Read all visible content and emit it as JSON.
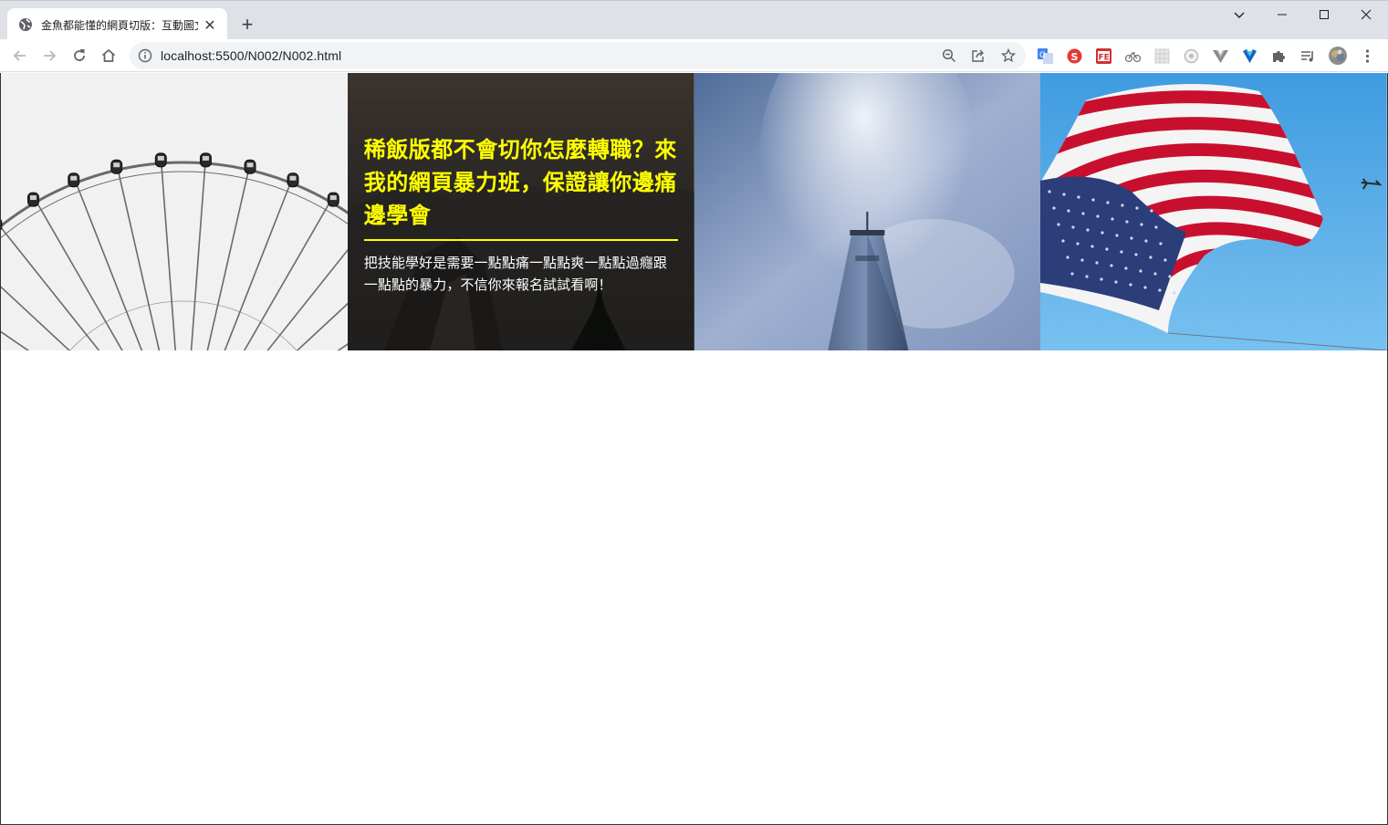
{
  "browser": {
    "tab": {
      "title": "金魚都能懂的網頁切版：互動圖文",
      "favicon": "globe-icon"
    },
    "address_bar": {
      "url": "localhost:5500/N002/N002.html"
    }
  },
  "page": {
    "headline": "稀飯版都不會切你怎麼轉職？來我的網頁暴力班，保證讓你邊痛邊學會",
    "body": "把技能學好是需要一點點痛一點點爽一點點過癮跟一點點的暴力，不信你來報名試試看啊！",
    "accent_color": "#ffff00",
    "panels": [
      "ferris-wheel",
      "mountain-forest",
      "skyscraper",
      "american-flag"
    ]
  }
}
